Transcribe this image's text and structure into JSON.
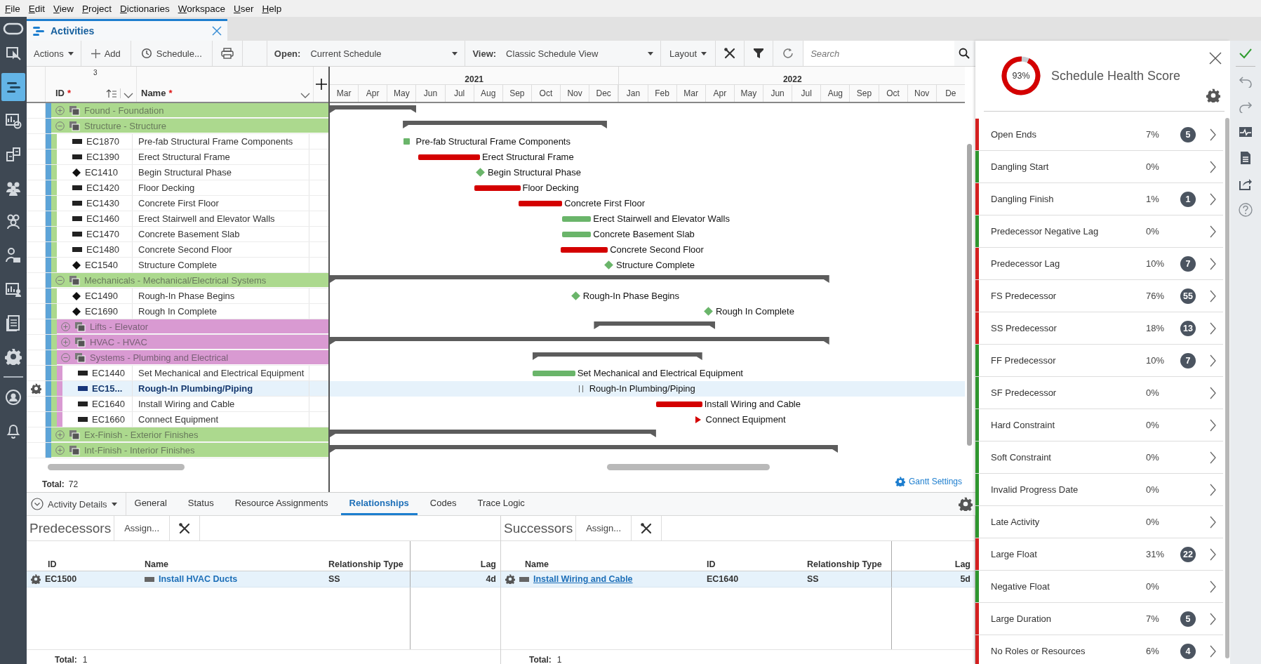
{
  "menu": [
    "File",
    "Edit",
    "View",
    "Project",
    "Dictionaries",
    "Workspace",
    "User",
    "Help"
  ],
  "rail": {
    "main": [
      {
        "selected": false
      },
      {
        "selected": true
      },
      {
        "selected": false
      },
      {
        "selected": false
      },
      {
        "selected": false
      },
      {
        "selected": false
      },
      {
        "selected": false
      },
      {
        "selected": false
      },
      {
        "selected": false
      },
      {
        "selected": false
      }
    ],
    "account": [
      {
        "selected": false
      },
      {
        "selected": false
      }
    ]
  },
  "tab": {
    "title": "Activities"
  },
  "toolbar": {
    "actions": "Actions",
    "add": "Add",
    "schedule": "Schedule...",
    "open_label": "Open:",
    "open_value": "Current Schedule",
    "view_label": "View:",
    "view_value": "Classic Schedule View",
    "layout": "Layout",
    "search": {
      "placeholder": "Search"
    }
  },
  "table": {
    "sort_level": "3",
    "columns": [
      {
        "label": "ID",
        "mark": "*"
      },
      {
        "label": "Name",
        "mark": "*"
      }
    ],
    "rows": [
      {
        "kind": "group",
        "title": "Found - Foundation",
        "color": "#acd98e",
        "expanded": false,
        "selected": false,
        "bar": {
          "kind": "summary"
        }
      },
      {
        "kind": "group",
        "title": "Structure - Structure",
        "color": "#acd98e",
        "expanded": true,
        "selected": false,
        "bar": {
          "kind": "summary"
        },
        "children": [
          {
            "kind": "task",
            "id": "EC1870",
            "name": "Pre-fab Structural Frame Components",
            "selected": false,
            "bar": {
              "kind": "marker",
              "label": "Pre-fab Structural Frame Components"
            }
          },
          {
            "kind": "task",
            "id": "EC1390",
            "name": "Erect Structural Frame",
            "selected": false,
            "bar": {
              "kind": "critical",
              "label": "Erect Structural Frame"
            }
          },
          {
            "kind": "milestone",
            "id": "EC1410",
            "name": "Begin Structural Phase",
            "selected": false,
            "bar": {
              "kind": "milestone",
              "label": "Begin Structural Phase"
            }
          },
          {
            "kind": "task",
            "id": "EC1420",
            "name": "Floor Decking",
            "selected": false,
            "bar": {
              "kind": "critical",
              "label": "Floor Decking"
            }
          },
          {
            "kind": "task",
            "id": "EC1430",
            "name": "Concrete First Floor",
            "selected": false,
            "bar": {
              "kind": "critical",
              "label": "Concrete First Floor"
            }
          },
          {
            "kind": "task",
            "id": "EC1460",
            "name": "Erect Stairwell and Elevator Walls",
            "selected": false,
            "bar": {
              "kind": "normal",
              "label": "Erect Stairwell and Elevator Walls"
            }
          },
          {
            "kind": "task",
            "id": "EC1470",
            "name": "Concrete Basement Slab",
            "selected": false,
            "bar": {
              "kind": "normal",
              "label": "Concrete Basement Slab"
            }
          },
          {
            "kind": "task",
            "id": "EC1480",
            "name": "Concrete Second Floor",
            "selected": false,
            "bar": {
              "kind": "critical",
              "label": "Concrete Second Floor"
            }
          },
          {
            "kind": "milestone",
            "id": "EC1540",
            "name": "Structure Complete",
            "selected": false,
            "bar": {
              "kind": "milestone",
              "label": "Structure Complete"
            }
          }
        ]
      },
      {
        "kind": "group",
        "title": "Mechanicals - Mechanical/Electrical Systems",
        "color": "#acd98e",
        "expanded": true,
        "selected": false,
        "bar": {
          "kind": "summary"
        },
        "children": [
          {
            "kind": "milestone",
            "id": "EC1490",
            "name": "Rough-In Phase Begins",
            "selected": false,
            "bar": {
              "kind": "milestone",
              "label": "Rough-In Phase Begins"
            }
          },
          {
            "kind": "milestone",
            "id": "EC1690",
            "name": "Rough In Complete",
            "selected": false,
            "bar": {
              "kind": "milestone",
              "label": "Rough In Complete"
            }
          },
          {
            "kind": "group",
            "title": "Lifts - Elevator",
            "color": "#d99ad2",
            "expanded": false,
            "selected": false,
            "bar": {
              "kind": "summary"
            }
          },
          {
            "kind": "group",
            "title": "HVAC - HVAC",
            "color": "#d99ad2",
            "expanded": false,
            "selected": false,
            "bar": {
              "kind": "summary"
            }
          },
          {
            "kind": "group",
            "title": "Systems - Plumbing and Electrical",
            "color": "#d99ad2",
            "expanded": true,
            "selected": false,
            "bar": {
              "kind": "summary"
            },
            "children": [
              {
                "kind": "task",
                "id": "EC1440",
                "name": "Set Mechanical and Electrical Equipment",
                "selected": false,
                "bar": {
                  "kind": "normal",
                  "label": "Set Mechanical and Electrical Equipment"
                }
              },
              {
                "kind": "task",
                "id": "EC15...",
                "name": "Rough-In Plumbing/Piping",
                "selected": true,
                "bar": {
                  "kind": "tick",
                  "label": "Rough-In Plumbing/Piping"
                }
              },
              {
                "kind": "task",
                "id": "EC1640",
                "name": "Install Wiring and Cable",
                "selected": false,
                "bar": {
                  "kind": "critical",
                  "label": "Install Wiring and Cable"
                }
              },
              {
                "kind": "task",
                "id": "EC1660",
                "name": "Connect Equipment",
                "selected": false,
                "bar": {
                  "kind": "arrow",
                  "label": "Connect Equipment"
                }
              }
            ]
          }
        ]
      },
      {
        "kind": "group",
        "title": "Ex-Finish - Exterior Finishes",
        "color": "#acd98e",
        "expanded": false,
        "selected": false,
        "bar": {
          "kind": "summary"
        }
      },
      {
        "kind": "group",
        "title": "Int-Finish - Interior Finishes",
        "color": "#acd98e",
        "expanded": false,
        "selected": false,
        "bar": {
          "kind": "summary"
        }
      }
    ],
    "total_label": "Total:",
    "total": "72"
  },
  "timeline": {
    "years": [
      {
        "label": "2021",
        "months": [
          "Mar",
          "Apr",
          "May",
          "Jun",
          "Jul",
          "Aug",
          "Sep",
          "Oct",
          "Nov",
          "Dec"
        ]
      },
      {
        "label": "2022",
        "months": [
          "Jan",
          "Feb",
          "Mar",
          "Apr",
          "May",
          "Jun",
          "Jul",
          "Aug",
          "Sep",
          "Oct",
          "Nov",
          "De"
        ]
      }
    ]
  },
  "gantt_settings": "Gantt Settings",
  "details": {
    "dropdown": "Activity Details",
    "tabs": [
      {
        "label": "General",
        "selected": false
      },
      {
        "label": "Status",
        "selected": false
      },
      {
        "label": "Resource Assignments",
        "selected": false
      },
      {
        "label": "Relationships",
        "selected": true
      },
      {
        "label": "Codes",
        "selected": false
      },
      {
        "label": "Trace Logic",
        "selected": false
      }
    ],
    "predecessors": {
      "title": "Predecessors",
      "assign": "Assign...",
      "columns": [
        "ID",
        "Name",
        "Relationship Type",
        "Lag"
      ],
      "rows": [
        {
          "id": "EC1500",
          "name": "Install HVAC Ducts",
          "type": "SS",
          "lag": "4d",
          "selected": true
        }
      ],
      "total_label": "Total:",
      "total": "1"
    },
    "successors": {
      "title": "Successors",
      "assign": "Assign...",
      "columns": [
        "Name",
        "ID",
        "Relationship Type",
        "Lag"
      ],
      "rows": [
        {
          "name": "Install Wiring and Cable",
          "id": "EC1640",
          "type": "SS",
          "lag": "5d",
          "selected": true
        }
      ],
      "total_label": "Total:",
      "total": "1"
    }
  },
  "health": {
    "score": "93%",
    "level": 0.93,
    "title": "Schedule Health Score",
    "checks": [
      {
        "name": "Open Ends",
        "percent": "7%",
        "count": "5",
        "color": "#d42020"
      },
      {
        "name": "Dangling Start",
        "percent": "0%",
        "color": "#2e962e"
      },
      {
        "name": "Dangling Finish",
        "percent": "1%",
        "count": "1",
        "color": "#d42020"
      },
      {
        "name": "Predecessor Negative Lag",
        "percent": "0%",
        "color": "#2e962e"
      },
      {
        "name": "Predecessor Lag",
        "percent": "10%",
        "count": "7",
        "color": "#d42020"
      },
      {
        "name": "FS Predecessor",
        "percent": "76%",
        "count": "55",
        "color": "#d42020"
      },
      {
        "name": "SS Predecessor",
        "percent": "18%",
        "count": "13",
        "color": "#d42020"
      },
      {
        "name": "FF Predecessor",
        "percent": "10%",
        "count": "7",
        "color": "#2e962e"
      },
      {
        "name": "SF Predecessor",
        "percent": "0%",
        "color": "#2e962e"
      },
      {
        "name": "Hard Constraint",
        "percent": "0%",
        "color": "#2e962e"
      },
      {
        "name": "Soft Constraint",
        "percent": "0%",
        "color": "#2e962e"
      },
      {
        "name": "Invalid Progress Date",
        "percent": "0%",
        "color": "#2e962e"
      },
      {
        "name": "Late Activity",
        "percent": "0%",
        "color": "#2e962e"
      },
      {
        "name": "Large Float",
        "percent": "31%",
        "count": "22",
        "color": "#d42020"
      },
      {
        "name": "Negative Float",
        "percent": "0%",
        "color": "#2e962e"
      },
      {
        "name": "Large Duration",
        "percent": "7%",
        "count": "5",
        "color": "#d42020"
      },
      {
        "name": "No Roles or Resources",
        "percent": "6%",
        "count": "4",
        "color": "#d42020"
      }
    ]
  }
}
